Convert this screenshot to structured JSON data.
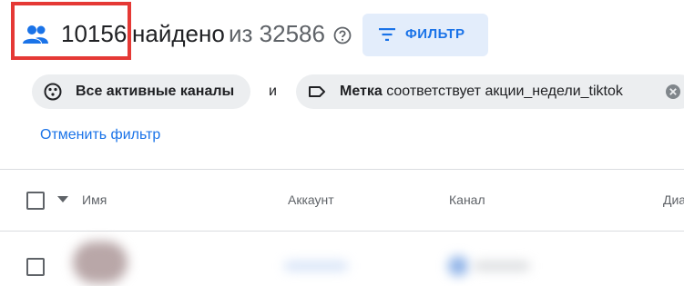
{
  "header": {
    "count": "10156",
    "found_label": "найдено",
    "total_label": "из 32586",
    "filter_button": "ФИЛЬТР",
    "icons": {
      "people": "people-icon",
      "help": "help-circle-icon",
      "filter": "filter-list-icon"
    }
  },
  "filters": {
    "chip1": {
      "bold": "Все активные каналы",
      "icon": "channels-icon"
    },
    "connector": "и",
    "chip2": {
      "bold": "Метка",
      "rest": " соответствует акции_недели_tiktok",
      "icon": "label-tag-icon"
    },
    "cancel_label": "Отменить фильтр"
  },
  "table": {
    "columns": [
      "Имя",
      "Аккаунт",
      "Канал",
      "Диа"
    ]
  },
  "colors": {
    "accent": "#1a73e8",
    "highlight": "#e53935",
    "chip_bg": "#eceef0",
    "button_bg": "#e3edfb"
  }
}
